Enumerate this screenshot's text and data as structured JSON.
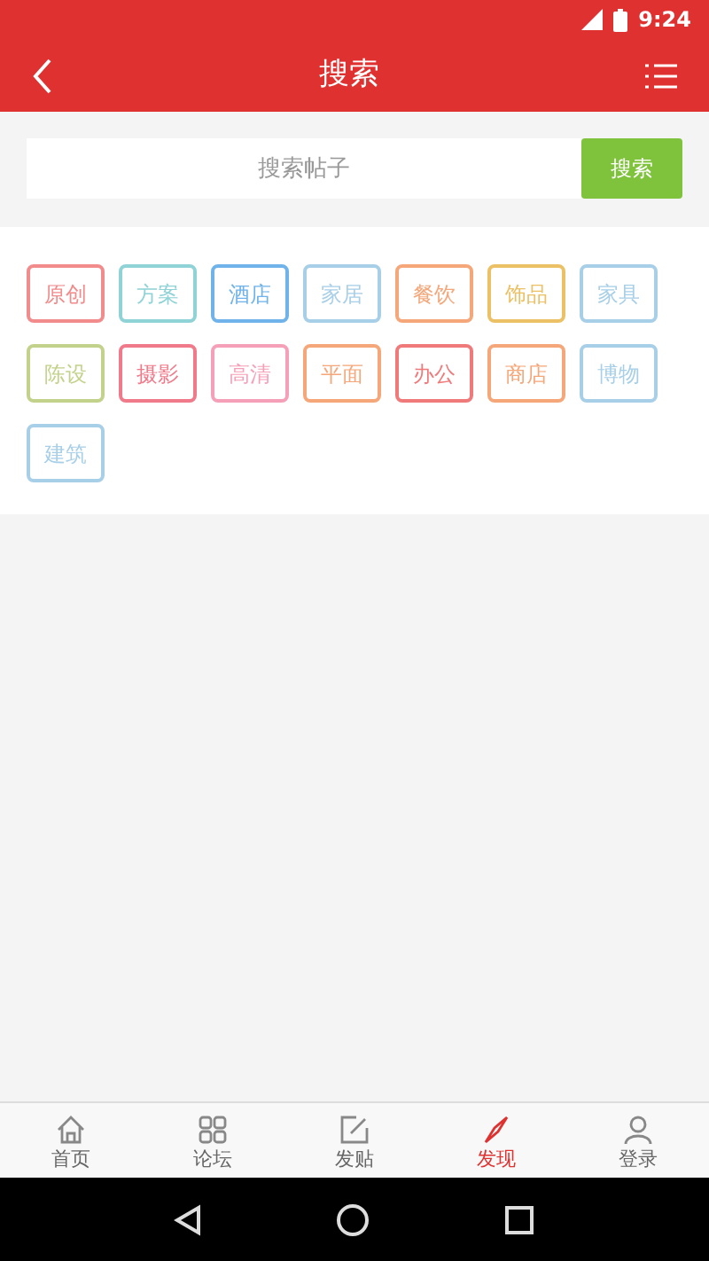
{
  "status_bar": {
    "time": "9:24"
  },
  "header": {
    "title": "搜索"
  },
  "search": {
    "placeholder": "搜索帖子",
    "button": "搜索"
  },
  "tags": [
    {
      "label": "原创",
      "color": "#f28b8b"
    },
    {
      "label": "方案",
      "color": "#8fd3d6"
    },
    {
      "label": "酒店",
      "color": "#6fb3ea"
    },
    {
      "label": "家居",
      "color": "#a8cfe8"
    },
    {
      "label": "餐饮",
      "color": "#f5a77a"
    },
    {
      "label": "饰品",
      "color": "#ecc064"
    },
    {
      "label": "家具",
      "color": "#a8cfe8"
    },
    {
      "label": "陈设",
      "color": "#c2d28a"
    },
    {
      "label": "摄影",
      "color": "#f07a8a"
    },
    {
      "label": "高清",
      "color": "#f5a0b8"
    },
    {
      "label": "平面",
      "color": "#f5a77a"
    },
    {
      "label": "办公",
      "color": "#f07a7a"
    },
    {
      "label": "商店",
      "color": "#f5a77a"
    },
    {
      "label": "博物",
      "color": "#a8cfe8"
    },
    {
      "label": "建筑",
      "color": "#a8cfe8"
    }
  ],
  "tab_bar": [
    {
      "label": "首页",
      "kind": "home",
      "selected": false
    },
    {
      "label": "论坛",
      "kind": "grid",
      "selected": false
    },
    {
      "label": "发贴",
      "kind": "edit",
      "selected": false
    },
    {
      "label": "发现",
      "kind": "compass",
      "selected": true
    },
    {
      "label": "登录",
      "kind": "user",
      "selected": false
    }
  ]
}
